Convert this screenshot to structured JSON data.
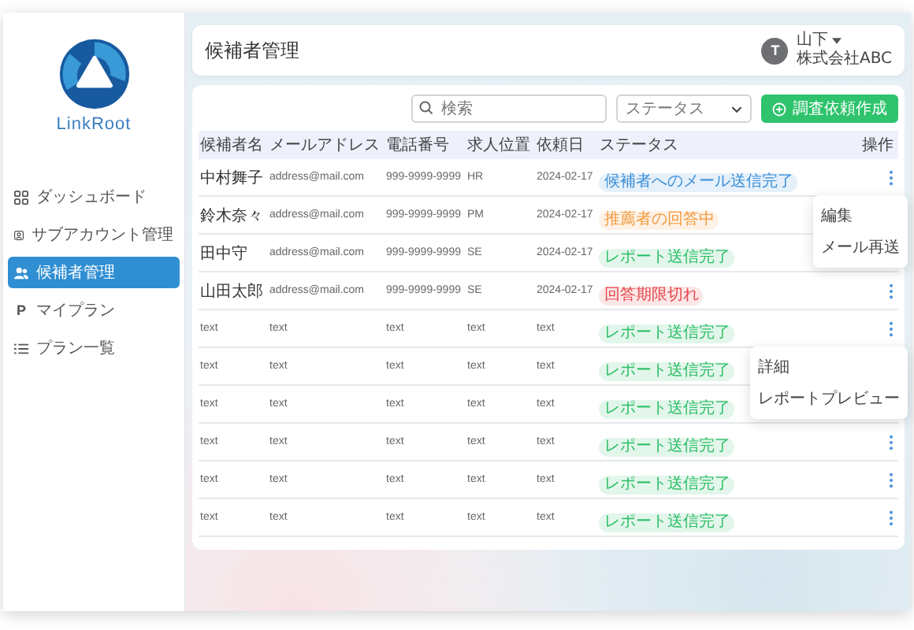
{
  "brand": {
    "name": "LinkRoot"
  },
  "sidebar": {
    "items": [
      {
        "kind": "grid",
        "label": "ダッシュボード",
        "selected": false
      },
      {
        "kind": "id-card",
        "label": "サブアカウント管理",
        "selected": false
      },
      {
        "kind": "users",
        "label": "候補者管理",
        "selected": true
      },
      {
        "kind": "letter",
        "glyph": "P",
        "label": "マイプラン",
        "selected": false
      },
      {
        "kind": "list",
        "label": "プラン一覧",
        "selected": false
      }
    ]
  },
  "header": {
    "title": "候補者管理",
    "user": {
      "initial": "T",
      "name": "山下",
      "company": "株式会社ABC"
    }
  },
  "toolbar": {
    "search": {
      "placeholder": "検索"
    },
    "status_filter": {
      "placeholder": "ステータス"
    },
    "create_button": "調査依頼作成"
  },
  "table": {
    "columns": [
      "候補者名",
      "メールアドレス",
      "電話番号",
      "求人位置",
      "依頼日",
      "ステータス",
      "操作"
    ],
    "rows": [
      {
        "cells": [
          "中村舞子",
          "address@mail.com",
          "999-9999-9999",
          "HR",
          "2024-02-17"
        ],
        "status": {
          "label": "候補者へのメール送信完了",
          "color": "#3b8fd9"
        },
        "menu": [
          "編集",
          "メール再送"
        ]
      },
      {
        "cells": [
          "鈴木奈々",
          "address@mail.com",
          "999-9999-9999",
          "PM",
          "2024-02-17"
        ],
        "status": {
          "label": "推薦者の回答中",
          "color": "#f29a3f"
        }
      },
      {
        "cells": [
          "田中守",
          "address@mail.com",
          "999-9999-9999",
          "SE",
          "2024-02-17"
        ],
        "status": {
          "label": "レポート送信完了",
          "color": "#2bbf66"
        }
      },
      {
        "cells": [
          "山田太郎",
          "address@mail.com",
          "999-9999-9999",
          "SE",
          "2024-02-17"
        ],
        "status": {
          "label": "回答期限切れ",
          "color": "#e5484d"
        }
      },
      {
        "cells": [
          "text",
          "text",
          "text",
          "text",
          "text"
        ],
        "status": {
          "label": "レポート送信完了",
          "color": "#2bbf66"
        },
        "menu": [
          "詳細",
          "レポートプレビュー"
        ]
      },
      {
        "cells": [
          "text",
          "text",
          "text",
          "text",
          "text"
        ],
        "status": {
          "label": "レポート送信完了",
          "color": "#2bbf66"
        }
      },
      {
        "cells": [
          "text",
          "text",
          "text",
          "text",
          "text"
        ],
        "status": {
          "label": "レポート送信完了",
          "color": "#2bbf66"
        }
      },
      {
        "cells": [
          "text",
          "text",
          "text",
          "text",
          "text"
        ],
        "status": {
          "label": "レポート送信完了",
          "color": "#2bbf66"
        }
      },
      {
        "cells": [
          "text",
          "text",
          "text",
          "text",
          "text"
        ],
        "status": {
          "label": "レポート送信完了",
          "color": "#2bbf66"
        }
      },
      {
        "cells": [
          "text",
          "text",
          "text",
          "text",
          "text"
        ],
        "status": {
          "label": "レポート送信完了",
          "color": "#2bbf66"
        }
      }
    ]
  }
}
